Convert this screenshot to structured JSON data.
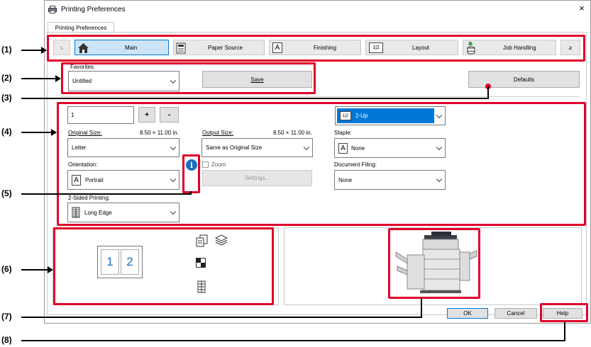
{
  "window": {
    "title": "Printing Preferences",
    "tab_label": "Printing Preferences",
    "close_glyph": "×"
  },
  "tabs": {
    "prev": "≤",
    "next": "≥",
    "items": [
      {
        "label": "Main",
        "icon": "home-icon",
        "selected": true
      },
      {
        "label": "Paper Source",
        "icon": "printer-tray-icon"
      },
      {
        "label": "Finishing",
        "icon": "finishing-icon"
      },
      {
        "label": "Layout",
        "icon": "layout-icon"
      },
      {
        "label": "Job Handling",
        "icon": "job-handling-icon"
      }
    ]
  },
  "favorites": {
    "label": "Favorites:",
    "value": "Untitled",
    "save_label": "Save"
  },
  "defaults_label": "Defaults",
  "copies": {
    "value": "1",
    "plus": "+",
    "minus": "-"
  },
  "original_size": {
    "label": "Original Size:",
    "dims": "8.50 × 11.00 in.",
    "value": "Letter"
  },
  "output_size": {
    "label": "Output Size:",
    "dims": "8.50 × 11.00 in.",
    "value": "Same as Original Size"
  },
  "orientation": {
    "label": "Orientation:",
    "value": "Portrait"
  },
  "zoom": {
    "label": "Zoom",
    "settings_label": "Settings..."
  },
  "two_sided": {
    "label": "2-Sided Printing:",
    "value": "Long Edge"
  },
  "nup": {
    "value": "2-Up",
    "icon_text": "1|2"
  },
  "staple": {
    "label": "Staple:",
    "value": "None"
  },
  "document_filing": {
    "label": "Document Filing:",
    "value": "None"
  },
  "preview": {
    "page1": "1",
    "page2": "2"
  },
  "footer": {
    "ok": "OK",
    "cancel": "Cancel",
    "help": "Help"
  },
  "callouts": [
    "(1)",
    "(2)",
    "(3)",
    "(4)",
    "(5)",
    "(6)",
    "(7)",
    "(8)"
  ],
  "colors": {
    "accent": "#0078d7",
    "callout_box": "#e0002a",
    "preview_page_blue": "#1f6fbf",
    "selected_tab": "#cce4f7"
  }
}
